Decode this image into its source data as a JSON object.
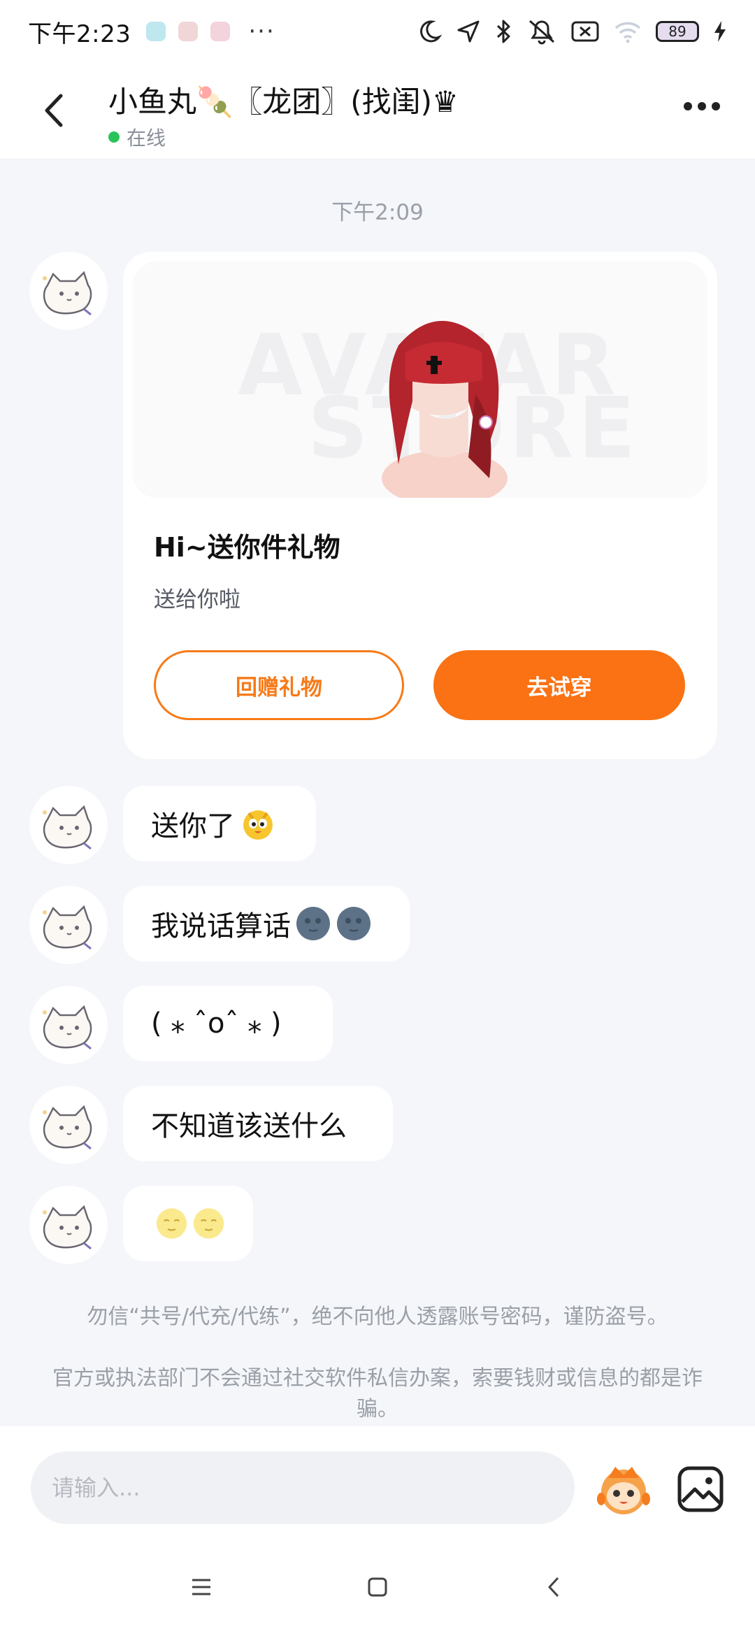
{
  "status_bar": {
    "time": "下午2:23",
    "more": "···",
    "battery": "89"
  },
  "header": {
    "contact_name": "小鱼丸🍡〖龙团〗(找闺)♛",
    "status": "在线"
  },
  "chat": {
    "timestamp": "下午2:09",
    "gift_card": {
      "watermark_line1": "AVATAR",
      "watermark_line2": "STORE",
      "title": "Hi~送你件礼物",
      "subtitle": "送给你啦",
      "return_gift_label": "回赠礼物",
      "try_on_label": "去试穿"
    },
    "messages": [
      {
        "text": "送你了"
      },
      {
        "text": "我说话算话"
      },
      {
        "text": "( ⁎ ˆoˆ ⁎ )"
      },
      {
        "text": "不知道该送什么"
      },
      {
        "text": ""
      }
    ],
    "notice_1": "勿信“共号/代充/代练”，绝不向他人透露账号密码，谨防盗号。",
    "notice_2": "官方或执法部门不会通过社交软件私信办案，索要钱财或信息的都是诈骗。"
  },
  "input": {
    "placeholder": "请输入..."
  },
  "colors": {
    "accent": "#fa7214",
    "online": "#2ac35a",
    "background": "#f5f6fa"
  },
  "icons": [
    "back-icon",
    "more-icon",
    "moon-icon",
    "location-icon",
    "bluetooth-icon",
    "mute-icon",
    "sim-icon",
    "wifi-icon",
    "battery-icon",
    "charging-icon",
    "mascot-icon",
    "image-icon",
    "menu-icon",
    "home-icon",
    "nav-back-icon"
  ]
}
